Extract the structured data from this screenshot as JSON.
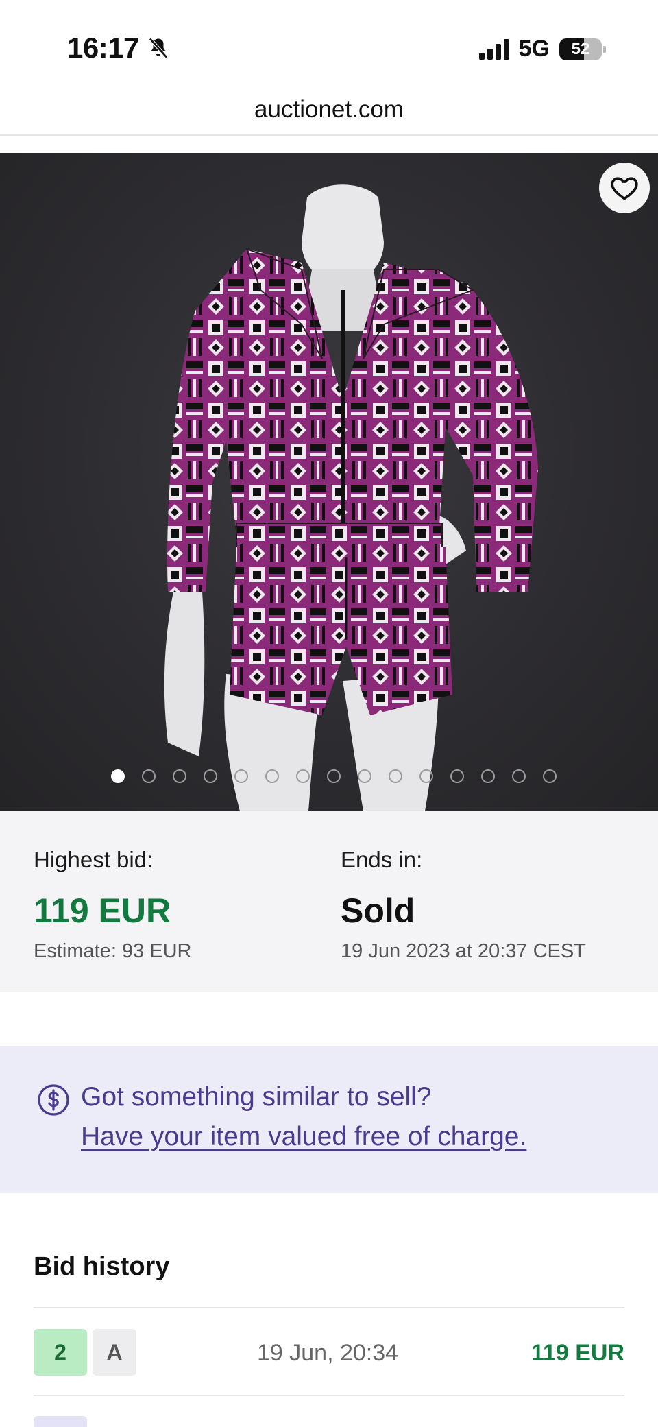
{
  "status_bar": {
    "time": "16:17",
    "network": "5G",
    "battery": "52",
    "silent_icon": "bell-slash-icon",
    "signal_icon": "signal-bars-icon"
  },
  "browser": {
    "url": "auctionet.com"
  },
  "gallery": {
    "favorite_icon": "heart-icon",
    "image_count": 15,
    "active_index": 0
  },
  "bid_summary": {
    "highest_label": "Highest bid:",
    "highest_value": "119 EUR",
    "estimate": "Estimate: 93 EUR",
    "ends_label": "Ends in:",
    "ends_value": "Sold",
    "ends_date": "19 Jun 2023 at 20:37 CEST"
  },
  "sell_banner": {
    "icon": "dollar-circle-icon",
    "title": "Got something similar to sell?",
    "link": "Have your item valued free of charge."
  },
  "bid_history": {
    "title": "Bid history",
    "rows": [
      {
        "number": "2",
        "user": "A",
        "time": "19 Jun, 20:34",
        "amount": "119 EUR"
      }
    ]
  },
  "colors": {
    "bid_green": "#127a3e",
    "banner_bg": "#ecebf8",
    "banner_text": "#4a3b8f",
    "summary_bg": "#f4f4f6"
  }
}
